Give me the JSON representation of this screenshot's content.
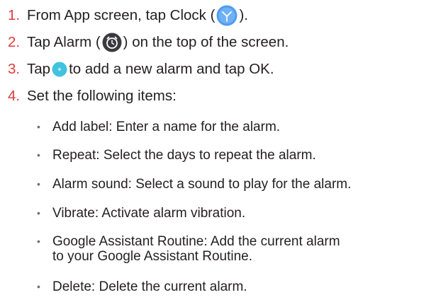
{
  "colors": {
    "step_number": "#e03a3e",
    "text": "#231f20",
    "clock_icon": "#4f9cf0",
    "alarm_icon_bg": "#3a3a3c",
    "add_button": "#41c3e0"
  },
  "steps": [
    {
      "num": "1.",
      "parts": [
        "From App screen, tap Clock (",
        ")."
      ],
      "icon": "clock-app-icon"
    },
    {
      "num": "2.",
      "parts": [
        "Tap Alarm (",
        ") on the top of the screen."
      ],
      "icon": "alarm-clock-icon"
    },
    {
      "num": "3.",
      "parts": [
        "Tap ",
        " to add a new alarm and tap OK."
      ],
      "icon": "add-button-icon"
    },
    {
      "num": "4.",
      "parts": [
        "Set the following items:"
      ]
    }
  ],
  "items": [
    {
      "lines": [
        "Add label: Enter a name for the alarm."
      ]
    },
    {
      "lines": [
        "Repeat: Select the days to repeat the alarm."
      ]
    },
    {
      "lines": [
        "Alarm sound: Select a sound to play for the alarm."
      ]
    },
    {
      "lines": [
        "Vibrate: Activate alarm vibration."
      ]
    },
    {
      "lines": [
        "Google Assistant Routine: Add the current alarm",
        "to your Google Assistant Routine."
      ]
    },
    {
      "lines": [
        "Delete: Delete the current alarm."
      ]
    }
  ]
}
